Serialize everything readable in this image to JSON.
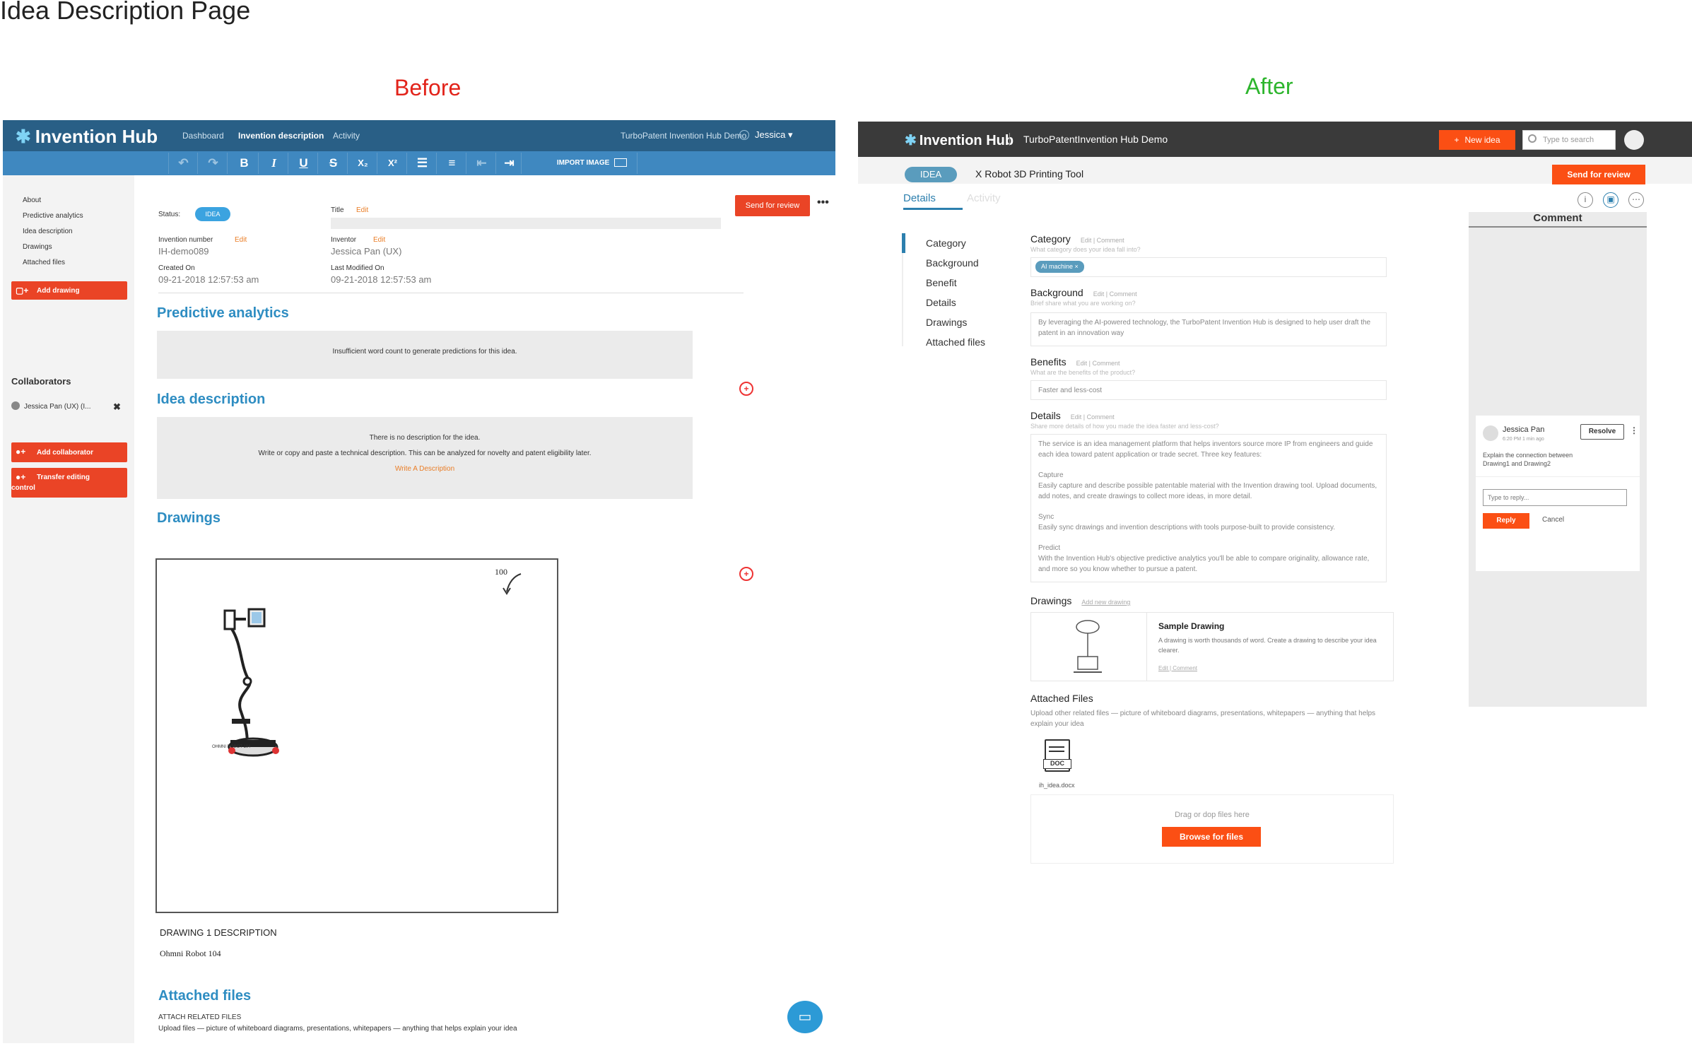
{
  "page_title": "Idea Description Page",
  "labels": {
    "before": "Before",
    "after": "After"
  },
  "colors": {
    "before_label": "#e2231a",
    "after_label": "#2db52d",
    "brand_blue": "#295f86",
    "accent_orange": "#fb4f14",
    "red_button": "#ea4426"
  },
  "before": {
    "nav": {
      "logo": "Invention Hub",
      "links": [
        "Dashboard",
        "Invention description",
        "Activity"
      ],
      "demo": "TurboPatent Invention Hub Demo",
      "user": "Jessica ▾"
    },
    "toolbar": {
      "buttons": [
        "↶",
        "↷",
        "B",
        "I",
        "U",
        "S",
        "X₂",
        "X²",
        "☰",
        "≡",
        "⇤",
        "⇥"
      ],
      "import_image": "IMPORT IMAGE"
    },
    "sidebar": {
      "links": [
        "About",
        "Predictive analytics",
        "Idea description",
        "Drawings",
        "Attached files"
      ],
      "add_drawing": "Add drawing",
      "collaborators_heading": "Collaborators",
      "collaborator": "Jessica Pan (UX)  (I...",
      "add_collaborator": "Add collaborator",
      "transfer_line1": "Transfer editing",
      "transfer_line2": "control"
    },
    "meta": {
      "status_label": "Status:",
      "status_value": "IDEA",
      "title_label": "Title",
      "edit": "Edit",
      "invention_number_label": "Invention number",
      "invention_number": "IH-demo089",
      "inventor_label": "Inventor",
      "inventor": "Jessica Pan (UX)",
      "created_label": "Created On",
      "created": "09-21-2018 12:57:53 am",
      "modified_label": "Last Modified On",
      "modified": "09-21-2018 12:57:53 am"
    },
    "send_for_review": "Send for review",
    "more": "•••",
    "predictive": {
      "heading": "Predictive analytics",
      "message": "Insufficient word count to generate predictions for this idea."
    },
    "idea": {
      "heading": "Idea description",
      "line1": "There is no description for the idea.",
      "line2": "Write or copy and paste a technical description. This can be analyzed for novelty and patent eligibility later.",
      "link": "Write A Description"
    },
    "drawings": {
      "heading": "Drawings",
      "ref_number": "100",
      "robot_caption": "OHMNI ROBOT 104",
      "desc_heading": "DRAWING 1 DESCRIPTION",
      "desc_text": "Ohmni Robot 104"
    },
    "attached": {
      "heading": "Attached files",
      "sub": "ATTACH RELATED FILES",
      "desc": "Upload files — picture of whiteboard diagrams, presentations, whitepapers — anything that helps explain your idea"
    }
  },
  "after": {
    "nav": {
      "logo": "Invention Hub",
      "demo": "TurboPatentInvention Hub Demo",
      "new_idea": "New idea",
      "search_placeholder": "Type to search"
    },
    "idea_pill": "IDEA",
    "idea_title": "X Robot 3D Printing Tool",
    "send_for_review": "Send for review",
    "tabs": [
      "Details",
      "Activity"
    ],
    "section_nav": [
      "Category",
      "Background",
      "Benefit",
      "Details",
      "Drawings",
      "Attached files"
    ],
    "category": {
      "heading": "Category",
      "edit_comment": "Edit | Comment",
      "hint": "What category does your idea fall into?",
      "tag": "AI machine"
    },
    "background": {
      "heading": "Background",
      "edit_comment": "Edit | Comment",
      "hint": "Brief share what you are working on?",
      "text": "By leveraging the AI-powered technology, the TurboPatent Invention Hub is designed to help user draft the patent in an innovation way"
    },
    "benefits": {
      "heading": "Benefits",
      "edit_comment": "Edit | Comment",
      "hint": "What are the benefits of the product?",
      "text": "Faster and less-cost"
    },
    "details": {
      "heading": "Details",
      "edit_comment": "Edit | Comment",
      "hint": "Share more details of how you made the idea faster and less-cost?",
      "intro": "The service is an idea management platform that helps inventors source more IP from engineers and guide each idea toward patent application or trade secret. Three key features:",
      "capture_title": "Capture",
      "capture_text": "Easily capture and describe possible patentable material with the Invention drawing tool. Upload documents, add notes, and create drawings to collect more ideas, in more detail.",
      "sync_title": "Sync",
      "sync_text": "Easily sync drawings and invention descriptions with tools purpose-built to provide consistency.",
      "predict_title": "Predict",
      "predict_text": "With the Invention Hub's objective predictive analytics you'll be able to compare originality, allowance rate, and more so you know whether to pursue a patent."
    },
    "drawings": {
      "heading": "Drawings",
      "add_link": "Add new drawing",
      "sample_title": "Sample Drawing",
      "sample_text": "A drawing is worth thousands of word. Create a drawing to describe your idea clearer.",
      "edit_comment": "Edit | Comment"
    },
    "attached": {
      "heading": "Attached Files",
      "hint": "Upload other related files — picture of whiteboard diagrams, presentations, whitepapers — anything that helps explain your idea",
      "file_type": "DOC",
      "file_name": "ih_idea.docx",
      "drop_text": "Drag or dop files here",
      "browse": "Browse for files"
    },
    "comment": {
      "heading": "Comment",
      "author": "Jessica Pan",
      "time": "6:20 PM  1 min ago",
      "resolve": "Resolve",
      "text": "Explain the connection between Drawing1 and Drawing2",
      "reply_placeholder": "Type to reply...",
      "reply": "Reply",
      "cancel": "Cancel"
    }
  }
}
